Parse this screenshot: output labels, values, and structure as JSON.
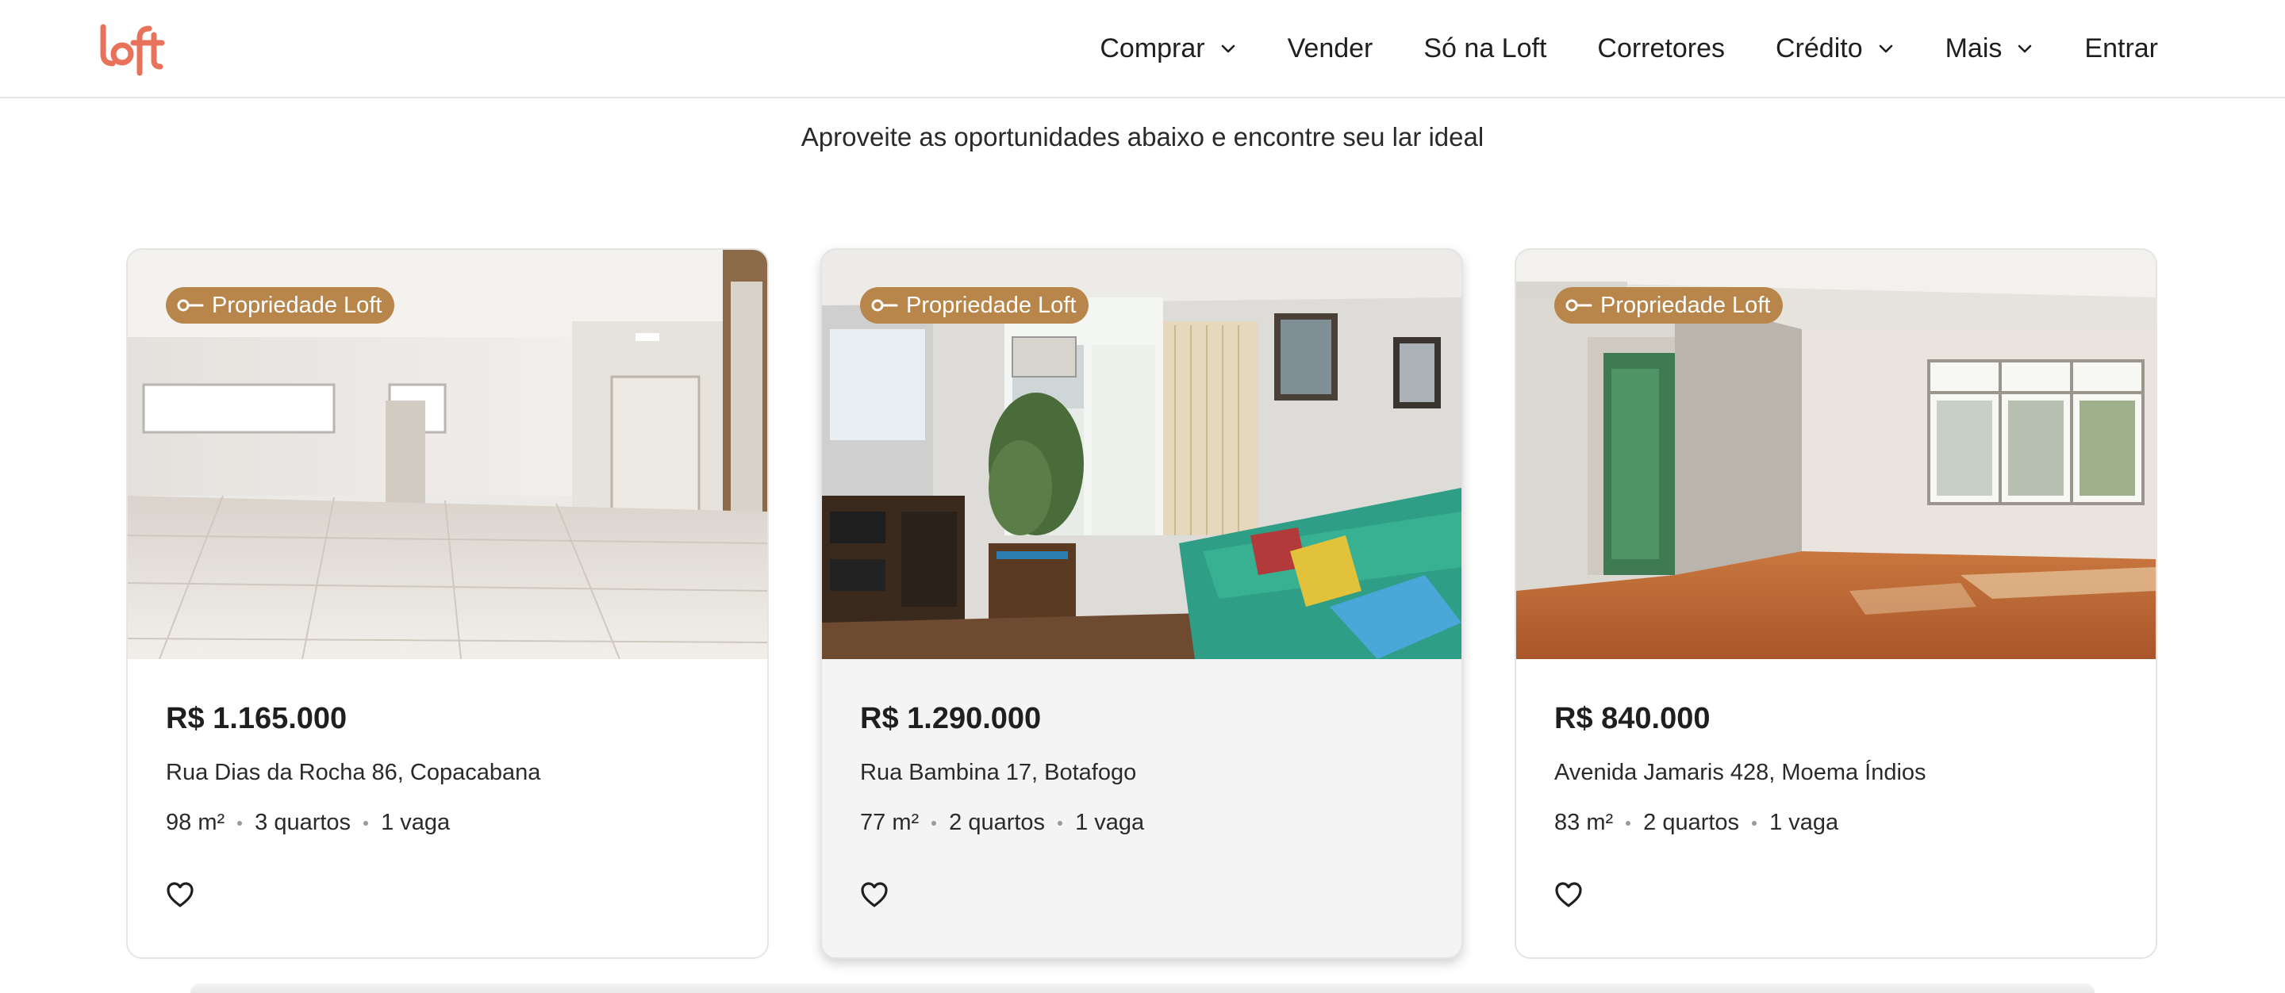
{
  "header": {
    "logo_text": "loft",
    "brand_color": "#e8735a",
    "nav": [
      {
        "label": "Comprar",
        "has_dropdown": true
      },
      {
        "label": "Vender",
        "has_dropdown": false
      },
      {
        "label": "Só na Loft",
        "has_dropdown": false
      },
      {
        "label": "Corretores",
        "has_dropdown": false
      },
      {
        "label": "Crédito",
        "has_dropdown": true
      },
      {
        "label": "Mais",
        "has_dropdown": true
      },
      {
        "label": "Entrar",
        "has_dropdown": false
      }
    ]
  },
  "subtitle": "Aproveite as oportunidades abaixo e encontre seu lar ideal",
  "badge_color": "#b8864b",
  "listings": [
    {
      "badge": "Propriedade Loft",
      "price": "R$ 1.165.000",
      "address": "Rua Dias da Rocha 86, Copacabana",
      "area": "98 m²",
      "rooms": "3 quartos",
      "parking": "1 vaga",
      "image": "empty-white-living-room",
      "favorite_icon": "heart-outline-icon"
    },
    {
      "badge": "Propriedade Loft",
      "price": "R$ 1.290.000",
      "address": "Rua Bambina 17, Botafogo",
      "area": "77 m²",
      "rooms": "2 quartos",
      "parking": "1 vaga",
      "image": "furnished-living-room-green-sofa",
      "favorite_icon": "heart-outline-icon"
    },
    {
      "badge": "Propriedade Loft",
      "price": "R$ 840.000",
      "address": "Avenida Jamaris 428, Moema Índios",
      "area": "83 m²",
      "rooms": "2 quartos",
      "parking": "1 vaga",
      "image": "empty-room-wood-floor",
      "favorite_icon": "heart-outline-icon"
    }
  ]
}
